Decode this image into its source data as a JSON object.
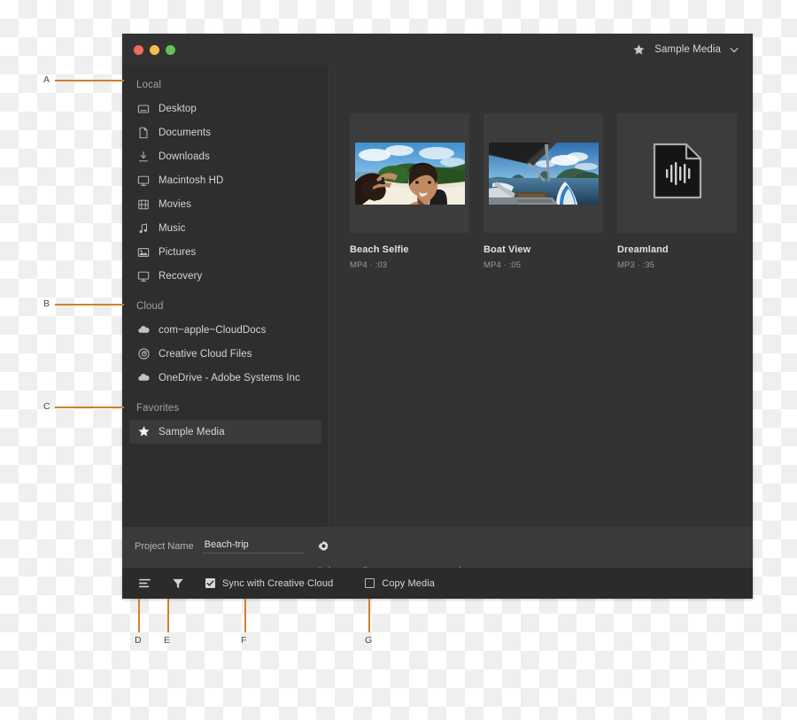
{
  "window": {
    "traffic_lights": [
      "close",
      "minimize",
      "maximize"
    ],
    "location_label": "Sample Media",
    "star_icon": "star-icon",
    "caret_icon": "chevron-down-icon"
  },
  "sidebar": {
    "sections": [
      {
        "header": "Local",
        "items": [
          {
            "label": "Desktop",
            "icon": "desktop-icon"
          },
          {
            "label": "Documents",
            "icon": "document-icon"
          },
          {
            "label": "Downloads",
            "icon": "download-icon"
          },
          {
            "label": "Macintosh HD",
            "icon": "display-icon"
          },
          {
            "label": "Movies",
            "icon": "film-icon"
          },
          {
            "label": "Music",
            "icon": "music-note-icon"
          },
          {
            "label": "Pictures",
            "icon": "picture-icon"
          },
          {
            "label": "Recovery",
            "icon": "display-icon"
          }
        ]
      },
      {
        "header": "Cloud",
        "items": [
          {
            "label": "com~apple~CloudDocs",
            "icon": "cloud-icon"
          },
          {
            "label": "Creative Cloud Files",
            "icon": "creative-cloud-icon"
          },
          {
            "label": "OneDrive - Adobe Systems Inc",
            "icon": "cloud-icon"
          }
        ]
      },
      {
        "header": "Favorites",
        "items": [
          {
            "label": "Sample Media",
            "icon": "star-icon",
            "selected": true
          }
        ]
      }
    ]
  },
  "media": {
    "items": [
      {
        "title": "Beach Selfie",
        "meta": "MP4 · :03",
        "kind": "video",
        "thumb": "beach-selfie-thumbnail"
      },
      {
        "title": "Boat View",
        "meta": "MP4 · :05",
        "kind": "video",
        "thumb": "boat-view-thumbnail"
      },
      {
        "title": "Dreamland",
        "meta": "MP3 · :35",
        "kind": "audio",
        "thumb": "audio-file-icon"
      }
    ]
  },
  "project": {
    "name_label": "Project Name",
    "name_value": "Beach-trip",
    "name_placeholder": "Project Name",
    "settings_icon": "gear-icon",
    "hint": "Select media to create a new project."
  },
  "toolbar": {
    "sort_icon": "sort-list-icon",
    "filter_icon": "filter-funnel-icon",
    "checkboxes": [
      {
        "label": "Sync with Creative Cloud",
        "checked": true
      },
      {
        "label": "Copy Media",
        "checked": false
      }
    ]
  },
  "callouts": [
    {
      "id": "A",
      "letter": "A"
    },
    {
      "id": "B",
      "letter": "B"
    },
    {
      "id": "C",
      "letter": "C"
    },
    {
      "id": "D",
      "letter": "D"
    },
    {
      "id": "E",
      "letter": "E"
    },
    {
      "id": "F",
      "letter": "F"
    },
    {
      "id": "G",
      "letter": "G"
    }
  ],
  "colors": {
    "callout_line": "#d2802a",
    "window_bg": "#2e2e2e",
    "panel_bg": "#333333",
    "titlebar_bg": "#323232",
    "toolbar_bg": "#2b2b2b",
    "project_bar_bg": "#3a3a3a",
    "selection_bg": "#3b3b3b"
  }
}
